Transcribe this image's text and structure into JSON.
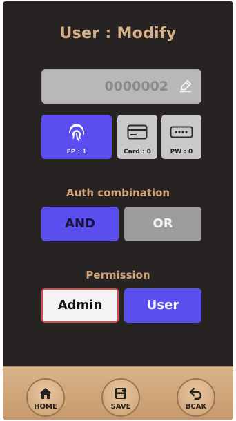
{
  "title": "User : Modify",
  "user_id": "0000002",
  "auth_methods": [
    {
      "label": "FP : 1",
      "icon": "fingerprint-icon",
      "selected": true
    },
    {
      "label": "Card : 0",
      "icon": "card-icon",
      "selected": false
    },
    {
      "label": "PW : 0",
      "icon": "password-icon",
      "selected": false
    }
  ],
  "auth_combination": {
    "label": "Auth combination",
    "options": [
      "AND",
      "OR"
    ],
    "selected": "AND"
  },
  "permission": {
    "label": "Permission",
    "options": [
      "Admin",
      "User"
    ],
    "selected": "User"
  },
  "nav": {
    "home": "HOME",
    "save": "SAVE",
    "back": "BCAK"
  },
  "colors": {
    "background": "#272322",
    "accent": "#5a4fee",
    "title": "#d6b088",
    "bottom_bar": "#d9b389"
  }
}
